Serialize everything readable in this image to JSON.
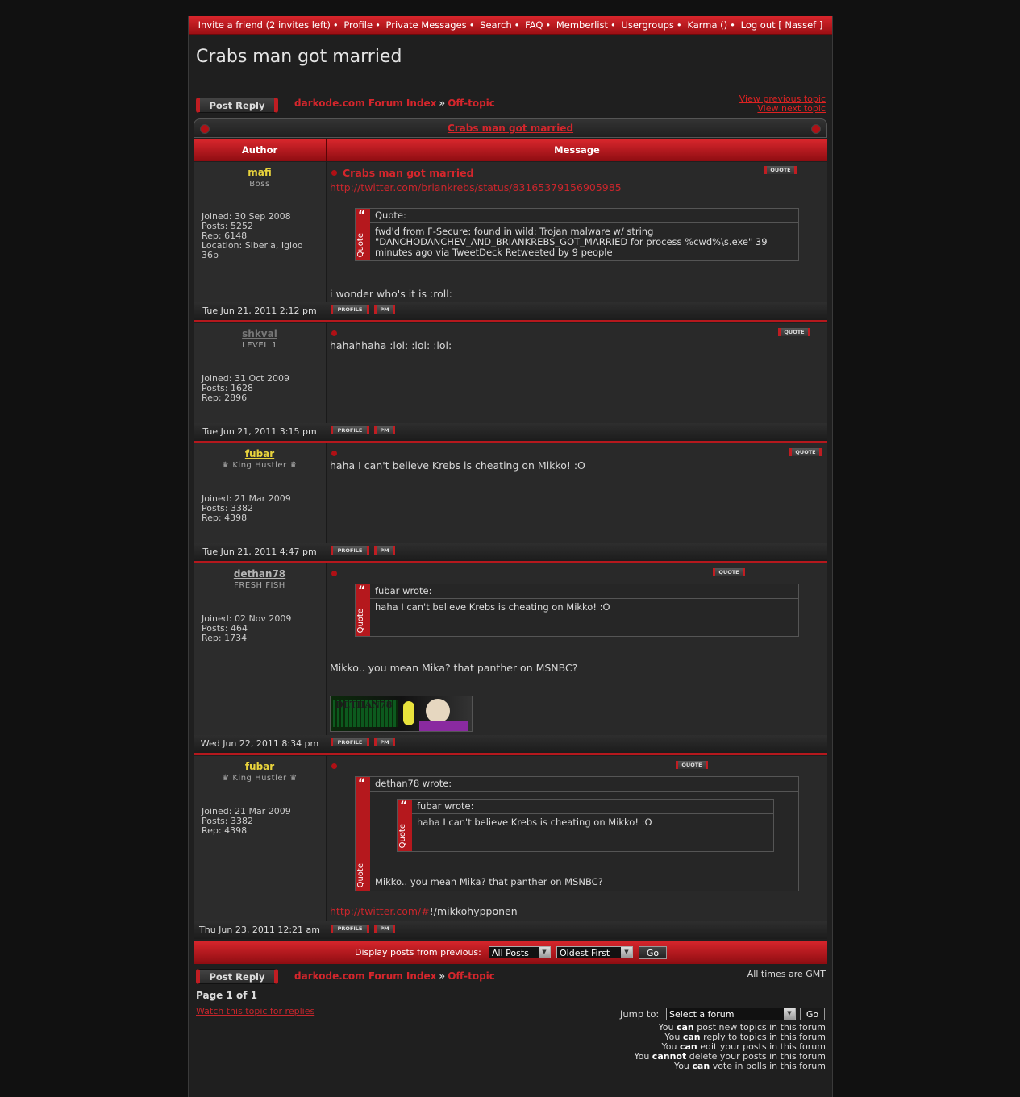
{
  "nav": {
    "items": [
      "Invite a friend (2 invites left)",
      "Profile",
      "Private Messages",
      "Search",
      "FAQ",
      "Memberlist",
      "Usergroups",
      "Karma ()"
    ],
    "logout": "Log out [ Nassef ]",
    "separator": "•"
  },
  "page_title": "Crabs man got married",
  "post_reply_label": "Post Reply",
  "breadcrumb": {
    "forum_index": "darkode.com Forum Index",
    "sep": "»",
    "subforum": "Off-topic"
  },
  "topic_nav": {
    "prev": "View previous topic",
    "next": "View next topic"
  },
  "table_title": "Crabs man got married",
  "columns": {
    "author": "Author",
    "message": "Message"
  },
  "buttons": {
    "quote": "QUOTE",
    "profile": "PROFILE",
    "pm": "PM"
  },
  "quote_label": "Quote",
  "posts": [
    {
      "author": "mafi",
      "author_color": "#e8d33c",
      "rank": "Boss",
      "joined": "Joined: 30 Sep 2008",
      "posts": "Posts: 5252",
      "rep": "Rep: 6148",
      "location": "Location: Siberia, Igloo 36b",
      "title": "Crabs man got married",
      "link": "http://twitter.com/briankrebs/status/83165379156905985",
      "quote_head": "Quote:",
      "quote_body": "fwd'd from F-Secure: found in wild: Trojan malware w/ string \"DANCHODANCHEV_AND_BRIANKREBS_GOT_MARRIED for process %cwd%\\s.exe\" 39 minutes ago via TweetDeck Retweeted by 9 people",
      "text": "i wonder who's it is :roll:",
      "date": "Tue Jun 21, 2011 2:12 pm"
    },
    {
      "author": "shkval",
      "author_color": "#777777",
      "rank": "LEVEL 1",
      "joined": "Joined: 31 Oct 2009",
      "posts": "Posts: 1628",
      "rep": "Rep: 2896",
      "text": "hahahhaha :lol: :lol: :lol:",
      "date": "Tue Jun 21, 2011 3:15 pm"
    },
    {
      "author": "fubar",
      "author_color": "#e8d33c",
      "rank": "♛ King Hustler ♛",
      "joined": "Joined: 21 Mar 2009",
      "posts": "Posts: 3382",
      "rep": "Rep: 4398",
      "text": "haha I can't believe Krebs is cheating on Mikko! :O",
      "date": "Tue Jun 21, 2011 4:47 pm"
    },
    {
      "author": "dethan78",
      "author_color": "#b5b5b5",
      "rank": "FRESH FISH",
      "joined": "Joined: 02 Nov 2009",
      "posts": "Posts: 464",
      "rep": "Rep: 1734",
      "quote_head": "fubar wrote:",
      "quote_body": "haha I can't believe Krebs is cheating on Mikko! :O",
      "text": "Mikko.. you mean Mika? that panther on MSNBC?",
      "signature_text": "DETHAN78",
      "date": "Wed Jun 22, 2011 8:34 pm"
    },
    {
      "author": "fubar",
      "author_color": "#e8d33c",
      "rank": "♛ King Hustler ♛",
      "joined": "Joined: 21 Mar 2009",
      "posts": "Posts: 3382",
      "rep": "Rep: 4398",
      "quote_head": "dethan78 wrote:",
      "inner_quote_head": "fubar wrote:",
      "inner_quote_body": "haha I can't believe Krebs is cheating on Mikko! :O",
      "quote_body": "Mikko.. you mean Mika? that panther on MSNBC?",
      "link": "http://twitter.com/#",
      "text_after_link": "!/mikkohypponen",
      "date": "Thu Jun 23, 2011 12:21 am"
    }
  ],
  "display_bar": {
    "label": "Display posts from previous:",
    "posts_select": "All Posts",
    "order_select": "Oldest First",
    "go": "Go"
  },
  "footer": {
    "timezone": "All times are GMT",
    "page": "Page 1 of 1",
    "watch": "Watch this topic for replies",
    "jump_label": "Jump to:",
    "jump_select": "Select a forum",
    "go": "Go",
    "perms": [
      {
        "pre": "You",
        "verb": "can",
        "post": "post new topics in this forum"
      },
      {
        "pre": "You",
        "verb": "can",
        "post": "reply to topics in this forum"
      },
      {
        "pre": "You",
        "verb": "can",
        "post": "edit your posts in this forum"
      },
      {
        "pre": "You",
        "verb": "cannot",
        "post": "delete your posts in this forum"
      },
      {
        "pre": "You",
        "verb": "can",
        "post": "vote in polls in this forum"
      }
    ]
  }
}
